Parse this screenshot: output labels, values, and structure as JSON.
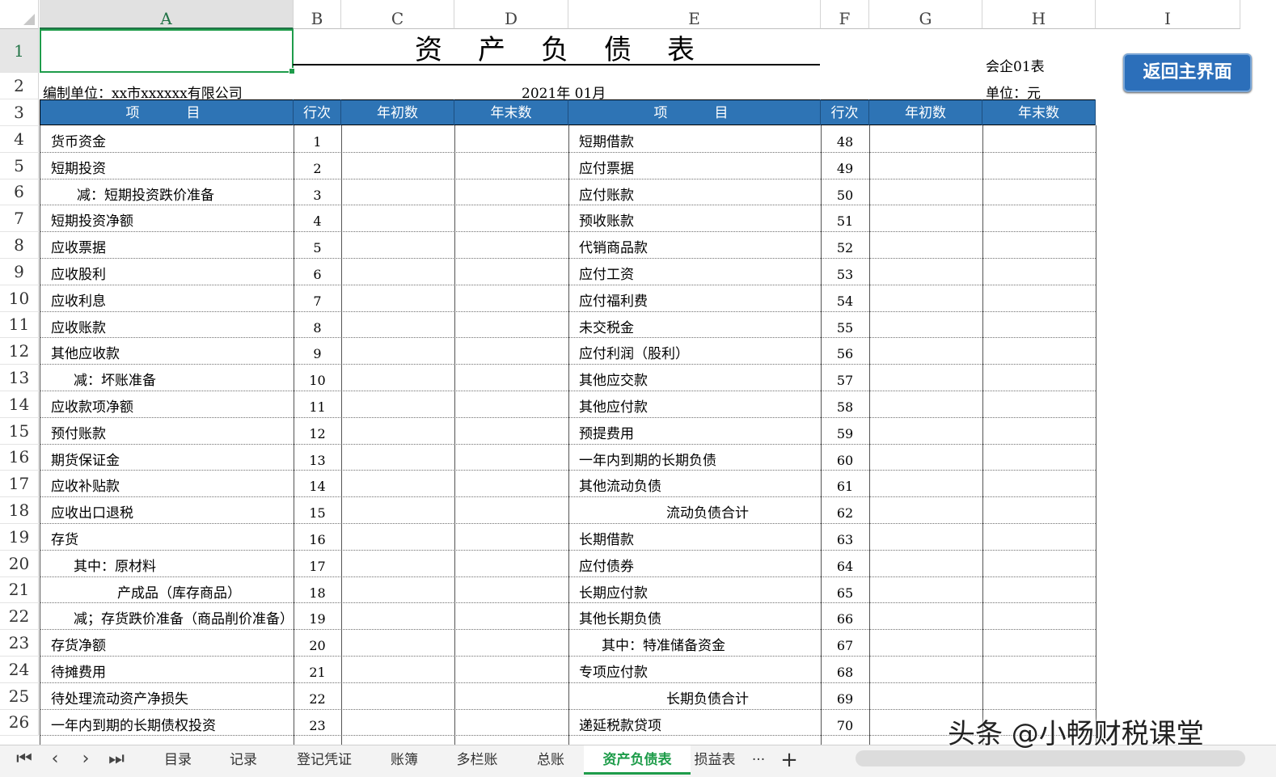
{
  "columns": [
    "A",
    "B",
    "C",
    "D",
    "E",
    "F",
    "G",
    "H",
    "I"
  ],
  "sheet": {
    "title": "资产负债表",
    "form_code": "会企01表",
    "unit_label": "单位：元",
    "company": "编制单位：xx市xxxxxx有限公司",
    "period": "2021年 01月"
  },
  "button_home": "返回主界面",
  "table_headers": {
    "left_item": "项　　目",
    "left_line": "行次",
    "left_begin": "年初数",
    "left_end": "年末数",
    "right_item": "项　　目",
    "right_line": "行次",
    "right_begin": "年初数",
    "right_end": "年末数"
  },
  "rows": [
    {
      "left": "货币资金",
      "ln": "1",
      "right": "短期借款",
      "rn": "48"
    },
    {
      "left": "短期投资",
      "ln": "2",
      "right": "应付票据",
      "rn": "49"
    },
    {
      "left": "减：短期投资跌价准备",
      "ln": "3",
      "right": "应付账款",
      "rn": "50"
    },
    {
      "left": "短期投资净额",
      "ln": "4",
      "right": "预收账款",
      "rn": "51"
    },
    {
      "left": "应收票据",
      "ln": "5",
      "right": "代销商品款",
      "rn": "52"
    },
    {
      "left": "应收股利",
      "ln": "6",
      "right": "应付工资",
      "rn": "53"
    },
    {
      "left": "应收利息",
      "ln": "7",
      "right": "应付福利费",
      "rn": "54"
    },
    {
      "left": "应收账款",
      "ln": "8",
      "right": "未交税金",
      "rn": "55"
    },
    {
      "left": "其他应收款",
      "ln": "9",
      "right": "应付利润（股利）",
      "rn": "56"
    },
    {
      "left": "减：坏账准备",
      "ln": "10",
      "right": "其他应交款",
      "rn": "57"
    },
    {
      "left": "应收款项净额",
      "ln": "11",
      "right": "其他应付款",
      "rn": "58"
    },
    {
      "left": "预付账款",
      "ln": "12",
      "right": "预提费用",
      "rn": "59"
    },
    {
      "left": "期货保证金",
      "ln": "13",
      "right": "一年内到期的长期负债",
      "rn": "60"
    },
    {
      "left": "应收补贴款",
      "ln": "14",
      "right": "其他流动负债",
      "rn": "61"
    },
    {
      "left": "应收出口退税",
      "ln": "15",
      "right": "流动负债合计",
      "rn": "62"
    },
    {
      "left": "存货",
      "ln": "16",
      "right": "长期借款",
      "rn": "63"
    },
    {
      "left": "其中：原材料",
      "ln": "17",
      "right": "应付债券",
      "rn": "64"
    },
    {
      "left": "产成品（库存商品）",
      "ln": "18",
      "right": "长期应付款",
      "rn": "65"
    },
    {
      "left": "减；存货跌价准备（商品削价准备）",
      "ln": "19",
      "right": "其他长期负债",
      "rn": "66"
    },
    {
      "left": "存货净额",
      "ln": "20",
      "right": "其中：特准储备资金",
      "rn": "67"
    },
    {
      "left": "待摊费用",
      "ln": "21",
      "right": "专项应付款",
      "rn": "68"
    },
    {
      "left": "待处理流动资产净损失",
      "ln": "22",
      "right": "长期负债合计",
      "rn": "69"
    },
    {
      "left": "一年内到期的长期债权投资",
      "ln": "23",
      "right": "递延税款贷项",
      "rn": "70"
    }
  ],
  "row_numbers": [
    "1",
    "2",
    "3",
    "4",
    "5",
    "6",
    "7",
    "8",
    "9",
    "10",
    "11",
    "12",
    "13",
    "14",
    "15",
    "16",
    "17",
    "18",
    "19",
    "20",
    "21",
    "22",
    "23",
    "24",
    "25",
    "26"
  ],
  "tabs": [
    "目录",
    "记录",
    "登记凭证",
    "账簿",
    "多栏账",
    "总账",
    "资产负债表",
    "损益表"
  ],
  "active_tab": "资产负债表",
  "tab_more": "···",
  "tab_add": "+",
  "nav": {
    "first": "⏮",
    "prev": "‹",
    "next": "›",
    "last": "⏭"
  },
  "watermark": "头条 @小畅财税课堂"
}
